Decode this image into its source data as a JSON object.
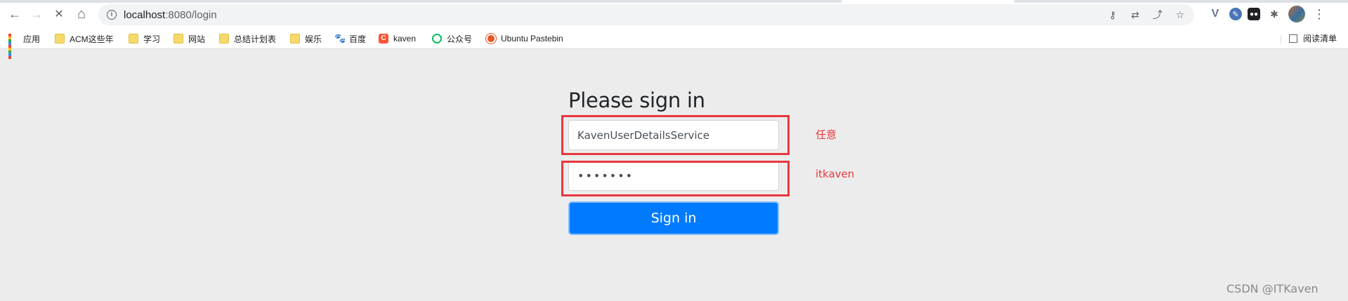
{
  "browser": {
    "url_host": "localhost",
    "url_path": ":8080/login",
    "nav": {
      "back": "←",
      "forward": "→",
      "stop": "✕",
      "home": "⌂"
    },
    "bookmarks": [
      {
        "label": "应用",
        "icon": "apps-grid-icon"
      },
      {
        "label": "ACM这些年",
        "icon": "folder-icon"
      },
      {
        "label": "学习",
        "icon": "folder-icon"
      },
      {
        "label": "网站",
        "icon": "folder-icon"
      },
      {
        "label": "总结计划表",
        "icon": "folder-icon"
      },
      {
        "label": "娱乐",
        "icon": "folder-icon"
      },
      {
        "label": "百度",
        "icon": "baidu-icon"
      },
      {
        "label": "kaven",
        "icon": "csdn-icon"
      },
      {
        "label": "公众号",
        "icon": "wechat-icon"
      },
      {
        "label": "Ubuntu Pastebin",
        "icon": "ubuntu-icon"
      }
    ],
    "reading_list": "阅读清单",
    "baidu_glyph": "🐾",
    "csdn_glyph": "C"
  },
  "form": {
    "heading": "Please sign in",
    "username_value": "KavenUserDetailsService",
    "password_value": "•••••••",
    "submit_label": "Sign in"
  },
  "annotations": {
    "username_note": "任意",
    "password_note": "itkaven",
    "color": "#e8383d"
  },
  "watermark": "CSDN @ITKaven",
  "colors": {
    "primary": "#007bff",
    "page_bg": "#ececec"
  }
}
